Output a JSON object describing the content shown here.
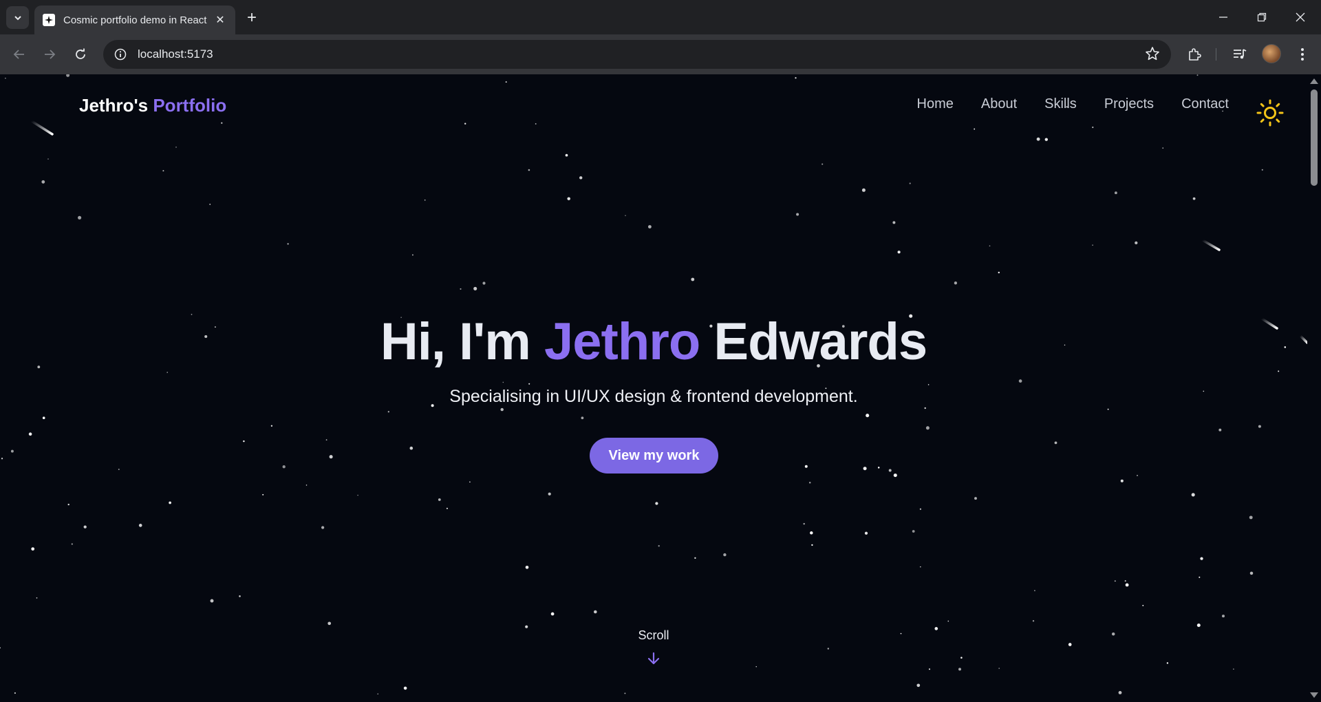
{
  "browser": {
    "tab_title": "Cosmic portfolio demo in React",
    "url": "localhost:5173",
    "icons": [
      "tab-search-icon",
      "favicon-sparkle-icon",
      "close-icon",
      "new-tab-icon",
      "minimize-icon",
      "restore-icon",
      "window-close-icon",
      "back-icon",
      "forward-icon",
      "reload-icon",
      "site-info-icon",
      "bookmark-star-icon",
      "extensions-icon",
      "media-queue-icon",
      "profile-avatar",
      "more-menu-icon"
    ]
  },
  "site": {
    "logo_name": "Jethro's",
    "logo_accent": "Portfolio",
    "nav": [
      "Home",
      "About",
      "Skills",
      "Projects",
      "Contact"
    ],
    "theme_icon": "sun-icon"
  },
  "hero": {
    "greeting": "Hi, I'm",
    "first_name": "Jethro",
    "last_name": "Edwards",
    "subtitle": "Specialising in UI/UX design & frontend development.",
    "cta_label": "View my work"
  },
  "scroll_hint": {
    "label": "Scroll",
    "icon": "arrow-down-icon"
  },
  "colors": {
    "background": "#050810",
    "accent": "#8b6ff0",
    "button": "#7c68e4",
    "sun": "#f5c518"
  }
}
